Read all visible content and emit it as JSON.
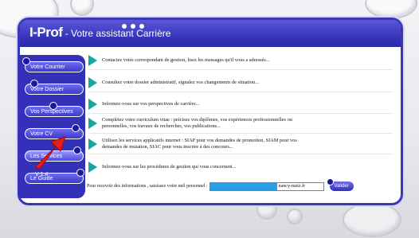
{
  "header": {
    "brand": "I-Prof",
    "subtitle": " - Votre assistant Carrière"
  },
  "sidebar": {
    "items": [
      {
        "label": "Votre Courrier"
      },
      {
        "label": "Votre Dossier"
      },
      {
        "label": "Vos Perspectives"
      },
      {
        "label": "Votre CV"
      },
      {
        "label": "Les Services"
      },
      {
        "label": "Le Guide"
      }
    ],
    "version": "V 1.4"
  },
  "content": {
    "rows": [
      {
        "text": "Contactez votre correspondant de gestion, lisez les messages qu'il vous a adressés..."
      },
      {
        "text": "Consultez votre dossier administratif, signalez vos changements de situation..."
      },
      {
        "text": "Informez-vous sur vos perspectives de carrière..."
      },
      {
        "text": "Complétez votre curriculum vitae : précisez vos diplômes, vos expériences professionnelles ou personnelles, vos travaux de recherches, vos publications..."
      },
      {
        "text": "Utilisez les services applicatifs internet : SIAP pour vos demandes de promotion, SIAM pour vos demandes de mutation, SIAC pour vous inscrire à des concours..."
      },
      {
        "text": "Informez-vous sur les procédures de gestion qui vous concernent..."
      }
    ]
  },
  "mail": {
    "label": "Pour recevoir des informations , saisissez votre mél personnel :",
    "domain_suffix": "nancy-metz.fr",
    "ok_label": "Valider"
  },
  "colors": {
    "frame": "#3a38b8",
    "accent_arrow": "#19a5a0",
    "pointer": "#e02020"
  }
}
